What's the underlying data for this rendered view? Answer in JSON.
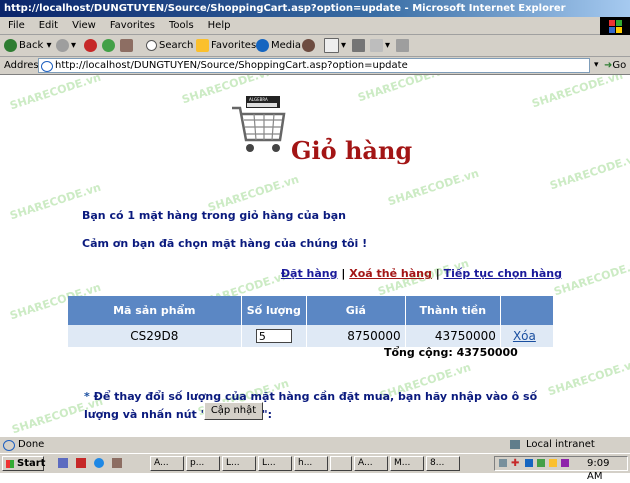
{
  "window": {
    "title": "http://localhost/DUNGTUYEN/Source/ShoppingCart.asp?option=update - Microsoft Internet Explorer"
  },
  "menu": [
    "File",
    "Edit",
    "View",
    "Favorites",
    "Tools",
    "Help"
  ],
  "toolbar": {
    "back": "Back",
    "search": "Search",
    "favorites": "Favorites",
    "media": "Media"
  },
  "address": {
    "label": "Address",
    "url": "http://localhost/DUNGTUYEN/Source/ShoppingCart.asp?option=update",
    "go": "Go"
  },
  "page": {
    "title": "Giỏ hàng",
    "cart_image_label": "ALGEBRA",
    "message1": "Bạn có 1 mặt hàng trong giỏ hàng của bạn",
    "message2": "Cảm ơn bạn đã chọn mặt hàng của chúng tôi !",
    "links": {
      "order": "Đặt hàng",
      "separator": "|",
      "delete_cart": "Xoá thẻ hàng",
      "continue": "Tiếp tục chọn hàng"
    },
    "table": {
      "headers": [
        "Mã sản phẩm",
        "Số lượng",
        "Giá",
        "Thành tiền",
        ""
      ],
      "rows": [
        {
          "code": "CS29D8",
          "qty": "5",
          "price": "8750000",
          "subtotal": "43750000",
          "action": "Xóa"
        }
      ]
    },
    "total": "Tổng cộng: 43750000",
    "note_star": "*",
    "note": "Để thay đổi số lượng của mặt hàng cần đặt mua, bạn hãy nhập vào ô số lượng và nhấn nút \"Cập nhật\":",
    "update_button": "Cập nhật",
    "watermark": "SHARECODE.vn"
  },
  "status": {
    "text": "Done",
    "zone": "Local intranet"
  },
  "taskbar": {
    "start": "Start",
    "tasks": [
      "A...",
      "p...",
      "L...",
      "L...",
      "h...",
      "",
      "A...",
      "M...",
      "8..."
    ],
    "clock": "9:09 AM"
  },
  "colors": {
    "title": "#a31515",
    "text": "#0a1a7e",
    "table_header": "#5b87c4",
    "table_row": "#dfe9f5",
    "link_red": "#a31515"
  }
}
